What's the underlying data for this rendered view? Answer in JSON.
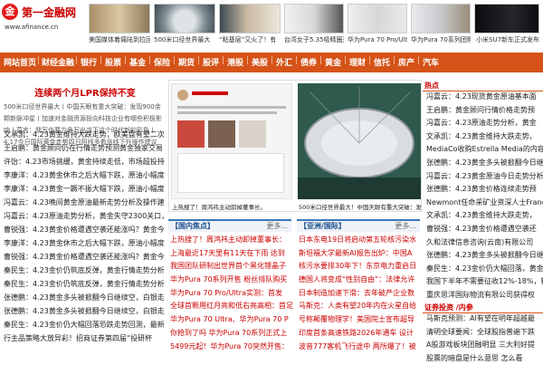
{
  "brand": {
    "name": "第一金融网",
    "url": "www.afinance.cn",
    "mark": "金"
  },
  "header_captions": [
    "美国媒体着痛陆到拉回",
    "500米口径世界最大",
    "“粘基层”又火了！有",
    "台湾女子5.35吸睛圈选",
    "华为Pura 70 Pro/Ult",
    "华为Pura 70系列团购",
    "小米SU7新车正式发布"
  ],
  "nav": [
    "网站首页",
    "财经金融",
    "银行",
    "股票",
    "基金",
    "保险",
    "期货",
    "股评",
    "港股",
    "美股",
    "外汇",
    "债券",
    "黄金",
    "理财",
    "信托",
    "房产",
    "汽车"
  ],
  "left": {
    "headline": "连续两个月LPR保持不变",
    "sub": "500米口径世界最大丨中国天眼有重大突破：发现900余颗新脉冲星丨加速对金融资源投向科技企业有哪些积极影响丨莫言：我写作要力争写出当下这个时代新的形象丨4.17今日国际黄金走势四日阳线多看涨线下升操作建议",
    "items": [
      {
        "a": "文承凯：",
        "b": "4.23黄金维持大跌走势，欧美盘有望二次"
      },
      {
        "a": "王启鹏：",
        "b": "黄金顾问仍在行情走势预测黄金独家交易"
      },
      {
        "a": "许饴：",
        "b": "4.23市场挑缓，黄金持续走低，市场超投持"
      },
      {
        "a": "李康洋：",
        "b": "4.23黄金休市之后大幅下跌，原油小幅度"
      },
      {
        "a": "李康洋：",
        "b": "4.23黄金一蹶不振大幅下跌，原油小幅度"
      },
      {
        "a": "冯嘉云：",
        "b": "4.23晚间黄金原油最新走势分析及操作建"
      },
      {
        "a": "冯嘉云：",
        "b": "4.23原油走势分析，黄金失守2300关口，"
      },
      {
        "a": "曹锐强：",
        "b": "4.23黄金价格遭遇空袭还能涨吗？黄金今"
      },
      {
        "a": "李康洋：",
        "b": "4.23黄金休市之后大幅下跌，原油小幅度"
      },
      {
        "a": "曹锐强：",
        "b": "4.23黄金价格遭遇空袭还能涨吗？黄金今"
      },
      {
        "a": "秦民生：",
        "b": "4.23金价仍筑底反弹，黄金行情走势分析"
      },
      {
        "a": "秦民生：",
        "b": "4.23金价仍筑底反弹，黄金行情走势分析"
      },
      {
        "a": "张德鹏：",
        "b": "4.23黄金多头被掀翻今日继续空，白银走势"
      },
      {
        "a": "张德鹏：",
        "b": "4.23黄金多头被掀翻今日继续空，白银走势"
      },
      {
        "a": "秦民生：",
        "b": "4.23金价仍大幅回落恐跌走势回测，最新行"
      },
      {
        "a": "",
        "b": "行主品策略大放异彩！招商证券第四届“投研杯"
      }
    ]
  },
  "mid": {
    "caption_left": "上热搜了！周鸿祎主动卸掉董事长。",
    "caption_right": "500米口径世界最大！中国天眼有重大突破：发现90",
    "section_left": "【国内焦点】",
    "section_right": "【亚洲/国际】",
    "more": "更多...",
    "list_left": [
      "上热搜了！周鸿祎主动卸掉董事长：",
      "上海最近17天里有11天在下雨 达到",
      "我国团队研制出世界首个黑化锂晶子",
      "华为Pura 70系列开售 粉丝排队购买",
      "华为Pura 70 Pro/Ultra实测：首发",
      "全球首颗用红月亮和低右亮高相：首足",
      "华为Pura 70 Ultra、华为Pura 70 P",
      "你抢到了吗 华为Pura 70系列正式上",
      "5499元起！华为Pura 70突然开售："
    ],
    "list_right": [
      "日本东电19日将启动第五轮核污染水",
      "斯坦福大学最新AI报告出炉：中国A",
      "核污水要排30年下！东京电力重启日",
      "德国人将变成“性别自由”：法律允许",
      "日本制造加速下滑：去年破产企业数",
      "马斯克：人类有望20年内在火星自给",
      "号称颠覆物理学！美国院士宣布超导",
      "印度首条高速铁路2026年通车 设计",
      "波音777客机飞行途中 两所爆了！被"
    ]
  },
  "right": {
    "tag": "热点",
    "items": [
      "冯嘉云：4.23现货黄金原油基本面",
      "王启鹏：黄金顾问行情价格走势预",
      "冯嘉云：4.23原油走势分析，黄金",
      "文承凯：4.23黄金维持大跌走势，",
      "MediaCo收购Estrella Media的内容",
      "张德鹏：4.23黄金多头被掀翻今日继",
      "冯嘉云：4.23黄金原油今日走势分析",
      "张德鹏：4.23黄金价格连续走势预",
      "Newmont任命采矿业资深人士Franc",
      "文承凯：4.23黄金维持大跌走势，",
      "曹锐强：4.23黄金价格遭遇空袭还",
      "久和法律信息咨询(云南)有限公司",
      "张德鹏：4.23黄金多头被掀翻今日继",
      "秦民生：4.23金价仍大幅回落，黄金失",
      "我国下半年不需要征收12%-18%，辅",
      "重庆思洋国际物流有限公司获得权"
    ],
    "section2": "证券投资 /内参",
    "items2": [
      "马斯克预测：AI有望在明年超越最",
      "清明全球要闻：全球股指普遍下跌",
      "A股游戏板块团融明显 三大利好提",
      "股票的暗盘是什么意思 怎么看"
    ]
  }
}
